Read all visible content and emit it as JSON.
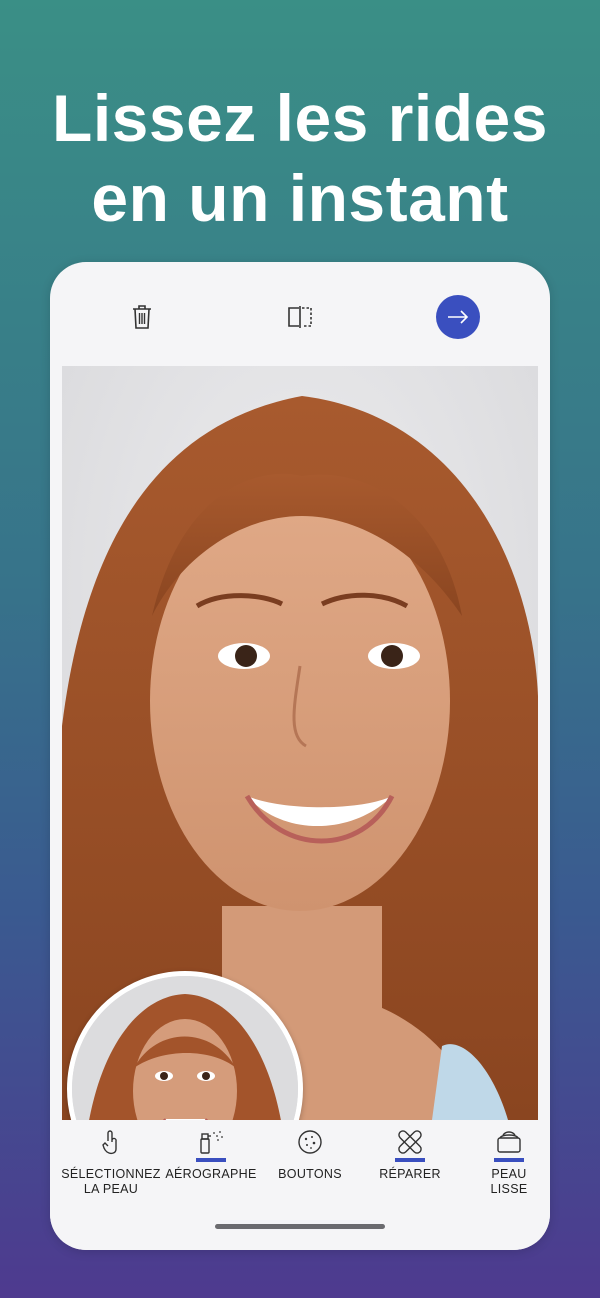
{
  "headline": {
    "line1": "Lissez les rides",
    "line2": "en un instant"
  },
  "topbar": {
    "delete_icon": "trash-icon",
    "compare_icon": "compare-icon",
    "next_icon": "arrow-right-icon",
    "accent": "#3a4fbf"
  },
  "photo": {
    "subject": "portrait"
  },
  "tools": [
    {
      "label": "SÉLECTIONNEZ\nLA PEAU",
      "icon": "finger-tap-icon",
      "active": false
    },
    {
      "label": "AÉROGRAPHE",
      "icon": "airbrush-icon",
      "active": true
    },
    {
      "label": "BOUTONS",
      "icon": "pimple-icon",
      "active": false
    },
    {
      "label": "RÉPARER",
      "icon": "bandage-icon",
      "active": true
    },
    {
      "label": "PEAU\nLISSE",
      "icon": "cream-jar-icon",
      "active": true
    }
  ]
}
